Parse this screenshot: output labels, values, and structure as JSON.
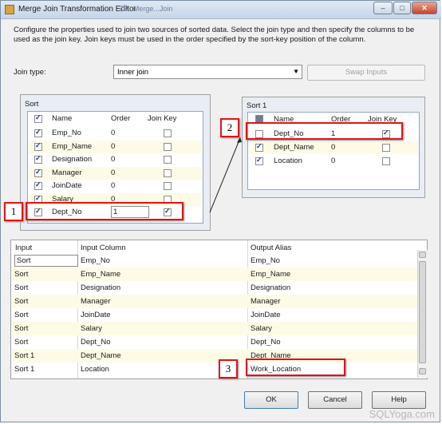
{
  "window": {
    "title": "Merge Join Transformation Editor",
    "title_ghost": "ZP...Merge...Join",
    "controls": [
      "–",
      "□",
      "✕"
    ]
  },
  "description": "Configure the properties used to join two sources of sorted data. Select the join type and then specify the columns to be used as the join key. Join keys must be used in the order specified by the sort-key position of the column.",
  "join": {
    "label": "Join type:",
    "value": "Inner join",
    "swap_label": "Swap Inputs"
  },
  "left_table": {
    "title": "Sort",
    "headers": [
      "Name",
      "Order",
      "Join Key"
    ],
    "rows": [
      {
        "name": "Emp_No",
        "order": "0",
        "selected": true,
        "join_key": false
      },
      {
        "name": "Emp_Name",
        "order": "0",
        "selected": true,
        "join_key": false
      },
      {
        "name": "Designation",
        "order": "0",
        "selected": true,
        "join_key": false
      },
      {
        "name": "Manager",
        "order": "0",
        "selected": true,
        "join_key": false
      },
      {
        "name": "JoinDate",
        "order": "0",
        "selected": true,
        "join_key": false
      },
      {
        "name": "Salary",
        "order": "0",
        "selected": true,
        "join_key": false
      },
      {
        "name": "Dept_No",
        "order": "1",
        "selected": true,
        "join_key": true
      }
    ]
  },
  "right_table": {
    "title": "Sort 1",
    "headers": [
      "Name",
      "Order",
      "Join Key"
    ],
    "rows": [
      {
        "name": "Dept_No",
        "order": "1",
        "selected": false,
        "join_key": true
      },
      {
        "name": "Dept_Name",
        "order": "0",
        "selected": true,
        "join_key": false
      },
      {
        "name": "Location",
        "order": "0",
        "selected": true,
        "join_key": false
      }
    ]
  },
  "mapping": {
    "headers": [
      "Input",
      "Input Column",
      "Output Alias"
    ],
    "rows": [
      {
        "input": "Sort",
        "column": "Emp_No",
        "alias": "Emp_No"
      },
      {
        "input": "Sort",
        "column": "Emp_Name",
        "alias": "Emp_Name"
      },
      {
        "input": "Sort",
        "column": "Designation",
        "alias": "Designation"
      },
      {
        "input": "Sort",
        "column": "Manager",
        "alias": "Manager"
      },
      {
        "input": "Sort",
        "column": "JoinDate",
        "alias": "JoinDate"
      },
      {
        "input": "Sort",
        "column": "Salary",
        "alias": "Salary"
      },
      {
        "input": "Sort",
        "column": "Dept_No",
        "alias": "Dept_No"
      },
      {
        "input": "Sort 1",
        "column": "Dept_Name",
        "alias": "Dept_Name"
      },
      {
        "input": "Sort 1",
        "column": "Location",
        "alias": "Work_Location"
      }
    ]
  },
  "badges": [
    "1",
    "2",
    "3"
  ],
  "buttons": {
    "ok": "OK",
    "cancel": "Cancel",
    "help": "Help"
  },
  "watermark": "SQLYoga.com",
  "colors": {
    "annotation_red": "#e01414",
    "row_alt": "#fdfbe6",
    "panel_border": "#8ea7c5"
  }
}
